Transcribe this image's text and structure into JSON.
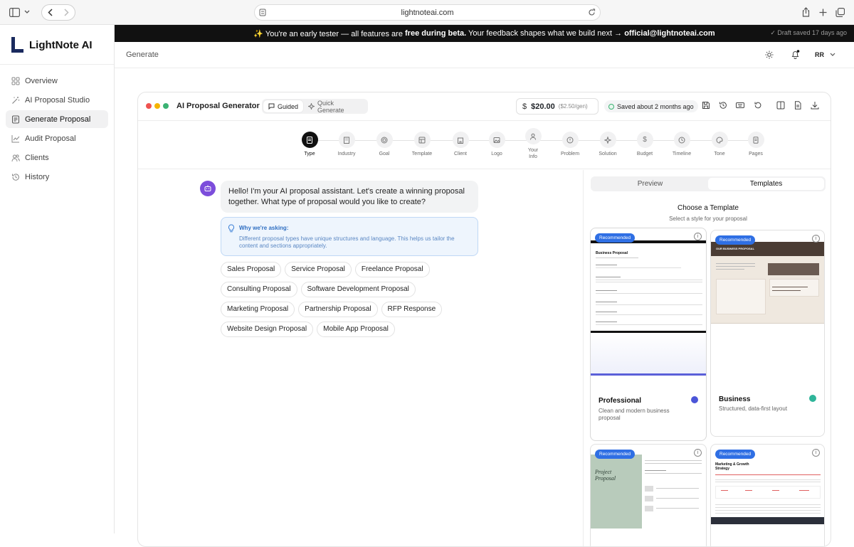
{
  "browser": {
    "url": "lightnoteai.com"
  },
  "app": {
    "name": "LightNote AI"
  },
  "sidebar": {
    "items": [
      {
        "label": "Overview",
        "icon": "grid-icon"
      },
      {
        "label": "AI Proposal Studio",
        "icon": "wand-icon"
      },
      {
        "label": "Generate Proposal",
        "icon": "document-icon",
        "active": true
      },
      {
        "label": "Audit Proposal",
        "icon": "chart-icon"
      },
      {
        "label": "Clients",
        "icon": "users-icon"
      },
      {
        "label": "History",
        "icon": "history-icon"
      }
    ]
  },
  "banner": {
    "prefix": "✨ You're an early tester — all features are ",
    "bold1": "free during beta.",
    "middle": " Your feedback shapes what we build next → ",
    "email": "official@lightnoteai.com",
    "draft": "✓ Draft saved 17 days ago"
  },
  "topbar": {
    "breadcrumb": "Generate",
    "user_initials": "RR"
  },
  "generator": {
    "title": "AI Proposal Generator",
    "mode_guided": "Guided",
    "mode_quick": "Quick Generate",
    "cost": "$20.00",
    "cost_per": "($2.50/gen)",
    "saved": "Saved about 2 months ago"
  },
  "steps": [
    {
      "label": "Type",
      "active": true
    },
    {
      "label": "Industry"
    },
    {
      "label": "Goal"
    },
    {
      "label": "Template"
    },
    {
      "label": "Client"
    },
    {
      "label": "Logo"
    },
    {
      "label": "Your Info"
    },
    {
      "label": "Problem"
    },
    {
      "label": "Solution"
    },
    {
      "label": "Budget"
    },
    {
      "label": "Timeline"
    },
    {
      "label": "Tone"
    },
    {
      "label": "Pages"
    }
  ],
  "chat": {
    "message": "Hello! I'm your AI proposal assistant. Let's create a winning proposal together. What type of proposal would you like to create?",
    "why_title": "Why we're asking:",
    "why_text": "Different proposal types have unique structures and language. This helps us tailor the content and sections appropriately.",
    "options": [
      "Sales Proposal",
      "Service Proposal",
      "Freelance Proposal",
      "Consulting Proposal",
      "Software Development Proposal",
      "Marketing Proposal",
      "Partnership Proposal",
      "RFP Response",
      "Website Design Proposal",
      "Mobile App Proposal"
    ]
  },
  "preview": {
    "tab_preview": "Preview",
    "tab_templates": "Templates",
    "heading": "Choose a Template",
    "subheading": "Select a style for your proposal",
    "templates": [
      {
        "badge": "Recommended",
        "name": "Professional",
        "desc": "Clean and modern business proposal",
        "color": "#4b55d8",
        "doc_title": "Business Proposal"
      },
      {
        "badge": "Recommended",
        "name": "Business",
        "desc": "Structured, data-first layout",
        "color": "#2fb59a",
        "doc_title": "OUR BUSINESS PROPOSAL"
      },
      {
        "badge": "Recommended",
        "doc_title": "Project Proposal"
      },
      {
        "badge": "Recommended",
        "doc_title": "Marketing & Growth Strategy"
      }
    ]
  }
}
